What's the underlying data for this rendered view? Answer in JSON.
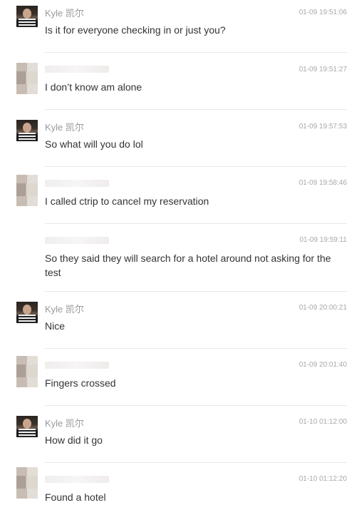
{
  "messages": [
    {
      "sender": "Kyle 凯尔",
      "time": "01-09 19:51:06",
      "text": "Is it for everyone checking in  or just you?"
    },
    {
      "sender": "",
      "time": "01-09 19:51:27",
      "text": "I don’t know am alone"
    },
    {
      "sender": "Kyle 凯尔",
      "time": "01-09 19:57:53",
      "text": "So what will you do lol"
    },
    {
      "sender": "",
      "time": "01-09 19:58:46",
      "text": "I called ctrip to cancel my reservation"
    },
    {
      "sender": "",
      "time": "01-09 19:59:11",
      "text": "So they said they will search for a hotel around not asking for the test"
    },
    {
      "sender": "Kyle 凯尔",
      "time": "01-09 20:00:21",
      "text": "Nice"
    },
    {
      "sender": "",
      "time": "01-09 20:01:40",
      "text": "Fingers crossed"
    },
    {
      "sender": "Kyle 凯尔",
      "time": "01-10 01:12:00",
      "text": "How did it go"
    },
    {
      "sender": "",
      "time": "01-10 01:12:20",
      "text": "Found a hotel"
    }
  ]
}
